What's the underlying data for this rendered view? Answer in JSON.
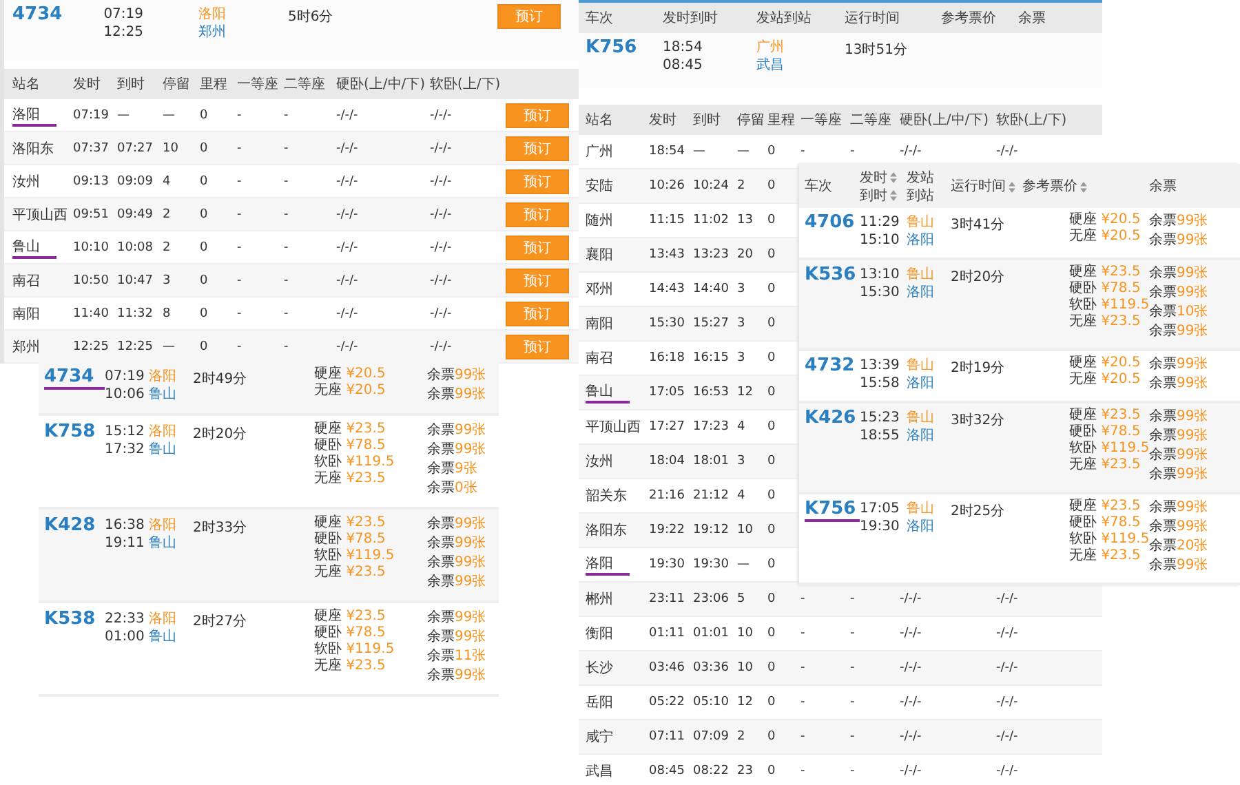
{
  "schedule_left": {
    "train": {
      "number": "4734",
      "depart": "07:19",
      "arrive": "12:25",
      "from": "洛阳",
      "to": "郑州",
      "duration": "5时6分",
      "button": "预订"
    },
    "columns": [
      "站名",
      "发时",
      "到时",
      "停留",
      "里程",
      "一等座",
      "二等座",
      "硬卧(上/中/下)",
      "软卧(上/下)"
    ],
    "stops": [
      {
        "name": "洛阳",
        "marked": true,
        "cells": [
          "07:19",
          "—",
          "—",
          "0",
          "-",
          "-",
          "-/-/-",
          "-/-/-"
        ],
        "button": "预订"
      },
      {
        "name": "洛阳东",
        "marked": false,
        "cells": [
          "07:37",
          "07:27",
          "10",
          "0",
          "-",
          "-",
          "-/-/-",
          "-/-/-"
        ],
        "button": "预订"
      },
      {
        "name": "汝州",
        "marked": false,
        "cells": [
          "09:13",
          "09:09",
          "4",
          "0",
          "-",
          "-",
          "-/-/-",
          "-/-/-"
        ],
        "button": "预订"
      },
      {
        "name": "平顶山西",
        "marked": false,
        "cells": [
          "09:51",
          "09:49",
          "2",
          "0",
          "-",
          "-",
          "-/-/-",
          "-/-/-"
        ],
        "button": "预订"
      },
      {
        "name": "鲁山",
        "marked": true,
        "cells": [
          "10:10",
          "10:08",
          "2",
          "0",
          "-",
          "-",
          "-/-/-",
          "-/-/-"
        ],
        "button": "预订"
      },
      {
        "name": "南召",
        "marked": false,
        "cells": [
          "10:50",
          "10:47",
          "3",
          "0",
          "-",
          "-",
          "-/-/-",
          "-/-/-"
        ],
        "button": "预订"
      },
      {
        "name": "南阳",
        "marked": false,
        "cells": [
          "11:40",
          "11:32",
          "8",
          "0",
          "-",
          "-",
          "-/-/-",
          "-/-/-"
        ],
        "button": "预订"
      },
      {
        "name": "郑州",
        "marked": false,
        "cells": [
          "12:25",
          "12:25",
          "—",
          "0",
          "-",
          "-",
          "-/-/-",
          "-/-/-"
        ],
        "button": "预订"
      }
    ]
  },
  "results_left": {
    "trains": [
      {
        "number": "4734",
        "marked": true,
        "depart": "07:19",
        "arrive": "10:06",
        "from": "洛阳",
        "to": "鲁山",
        "duration": "2时49分",
        "fares": [
          {
            "seat": "硬座",
            "price": "¥20.5"
          },
          {
            "seat": "无座",
            "price": "¥20.5"
          }
        ],
        "tickets": [
          {
            "label": "余票",
            "count": "99张"
          },
          {
            "label": "余票",
            "count": "99张"
          }
        ]
      },
      {
        "number": "K758",
        "marked": false,
        "depart": "15:12",
        "arrive": "17:32",
        "from": "洛阳",
        "to": "鲁山",
        "duration": "2时20分",
        "fares": [
          {
            "seat": "硬座",
            "price": "¥23.5"
          },
          {
            "seat": "硬卧",
            "price": "¥78.5"
          },
          {
            "seat": "软卧",
            "price": "¥119.5"
          },
          {
            "seat": "无座",
            "price": "¥23.5"
          }
        ],
        "tickets": [
          {
            "label": "余票",
            "count": "99张"
          },
          {
            "label": "余票",
            "count": "99张"
          },
          {
            "label": "余票",
            "count": "9张"
          },
          {
            "label": "余票",
            "count": "0张"
          }
        ]
      },
      {
        "number": "K428",
        "marked": false,
        "depart": "16:38",
        "arrive": "19:11",
        "from": "洛阳",
        "to": "鲁山",
        "duration": "2时33分",
        "fares": [
          {
            "seat": "硬座",
            "price": "¥23.5"
          },
          {
            "seat": "硬卧",
            "price": "¥78.5"
          },
          {
            "seat": "软卧",
            "price": "¥119.5"
          },
          {
            "seat": "无座",
            "price": "¥23.5"
          }
        ],
        "tickets": [
          {
            "label": "余票",
            "count": "99张"
          },
          {
            "label": "余票",
            "count": "99张"
          },
          {
            "label": "余票",
            "count": "99张"
          },
          {
            "label": "余票",
            "count": "99张"
          }
        ]
      },
      {
        "number": "K538",
        "marked": false,
        "depart": "22:33",
        "arrive": "01:00",
        "from": "洛阳",
        "to": "鲁山",
        "duration": "2时27分",
        "fares": [
          {
            "seat": "硬座",
            "price": "¥23.5"
          },
          {
            "seat": "硬卧",
            "price": "¥78.5"
          },
          {
            "seat": "软卧",
            "price": "¥119.5"
          },
          {
            "seat": "无座",
            "price": "¥23.5"
          }
        ],
        "tickets": [
          {
            "label": "余票",
            "count": "99张"
          },
          {
            "label": "余票",
            "count": "99张"
          },
          {
            "label": "余票",
            "count": "11张"
          },
          {
            "label": "余票",
            "count": "99张"
          }
        ]
      }
    ]
  },
  "schedule_right": {
    "columns": [
      "车次",
      "发时到时",
      "发站到站",
      "运行时间",
      "参考票价",
      "余票"
    ],
    "train": {
      "number": "K756",
      "depart": "18:54",
      "arrive": "08:45",
      "from": "广州",
      "to": "武昌",
      "duration": "13时51分"
    },
    "stop_columns": [
      "站名",
      "发时",
      "到时",
      "停留",
      "里程",
      "一等座",
      "二等座",
      "硬卧(上/中/下)",
      "软卧(上/下)"
    ],
    "stops": [
      {
        "name": "广州",
        "marked": false,
        "cells": [
          "18:54",
          "—",
          "—",
          "0",
          "-",
          "-",
          "-/-/-",
          "-/-/-"
        ]
      },
      {
        "name": "安陆",
        "marked": false,
        "cells": [
          "10:26",
          "10:24",
          "2",
          "0"
        ]
      },
      {
        "name": "随州",
        "marked": false,
        "cells": [
          "11:15",
          "11:02",
          "13",
          "0"
        ]
      },
      {
        "name": "襄阳",
        "marked": false,
        "cells": [
          "13:43",
          "13:23",
          "20",
          "0"
        ]
      },
      {
        "name": "邓州",
        "marked": false,
        "cells": [
          "14:43",
          "14:40",
          "3",
          "0"
        ]
      },
      {
        "name": "南阳",
        "marked": false,
        "cells": [
          "15:30",
          "15:27",
          "3",
          "0"
        ]
      },
      {
        "name": "南召",
        "marked": false,
        "cells": [
          "16:18",
          "16:15",
          "3",
          "0"
        ]
      },
      {
        "name": "鲁山",
        "marked": true,
        "cells": [
          "17:05",
          "16:53",
          "12",
          "0"
        ]
      },
      {
        "name": "平顶山西",
        "marked": false,
        "cells": [
          "17:27",
          "17:23",
          "4",
          "0"
        ]
      },
      {
        "name": "汝州",
        "marked": false,
        "cells": [
          "18:04",
          "18:01",
          "3",
          "0"
        ]
      },
      {
        "name": "韶关东",
        "marked": false,
        "cells": [
          "21:16",
          "21:12",
          "4",
          "0"
        ]
      },
      {
        "name": "洛阳东",
        "marked": false,
        "cells": [
          "19:22",
          "19:12",
          "10",
          "0"
        ]
      },
      {
        "name": "洛阳",
        "marked": true,
        "cells": [
          "19:30",
          "19:30",
          "—",
          "0"
        ]
      },
      {
        "name": "郴州",
        "marked": false,
        "cells": [
          "23:11",
          "23:06",
          "5",
          "0",
          "-",
          "-",
          "-/-/-",
          "-/-/-"
        ]
      },
      {
        "name": "衡阳",
        "marked": false,
        "cells": [
          "01:11",
          "01:01",
          "10",
          "0",
          "-",
          "-",
          "-/-/-",
          "-/-/-"
        ]
      },
      {
        "name": "长沙",
        "marked": false,
        "cells": [
          "03:46",
          "03:36",
          "10",
          "0",
          "-",
          "-",
          "-/-/-",
          "-/-/-"
        ]
      },
      {
        "name": "岳阳",
        "marked": false,
        "cells": [
          "05:22",
          "05:10",
          "12",
          "0",
          "-",
          "-",
          "-/-/-",
          "-/-/-"
        ]
      },
      {
        "name": "咸宁",
        "marked": false,
        "cells": [
          "07:11",
          "07:09",
          "2",
          "0",
          "-",
          "-",
          "-/-/-",
          "-/-/-"
        ]
      },
      {
        "name": "武昌",
        "marked": false,
        "cells": [
          "08:45",
          "08:22",
          "23",
          "0",
          "-",
          "-",
          "-/-/-",
          "-/-/-"
        ]
      }
    ]
  },
  "results_right": {
    "columns": [
      {
        "labels": [
          "车次"
        ],
        "sortable": false
      },
      {
        "labels": [
          "发时",
          "到时"
        ],
        "sortable": true
      },
      {
        "labels": [
          "发站",
          "到站"
        ],
        "sortable": false
      },
      {
        "labels": [
          "运行时间"
        ],
        "sortable": true
      },
      {
        "labels": [
          "参考票价"
        ],
        "sortable": true
      },
      {
        "labels": [
          "余票"
        ],
        "sortable": false
      }
    ],
    "trains": [
      {
        "number": "4706",
        "marked": false,
        "depart": "11:29",
        "arrive": "15:10",
        "from": "鲁山",
        "to": "洛阳",
        "duration": "3时41分",
        "fares": [
          {
            "seat": "硬座",
            "price": "¥20.5"
          },
          {
            "seat": "无座",
            "price": "¥20.5"
          }
        ],
        "tickets": [
          {
            "label": "余票",
            "count": "99张"
          },
          {
            "label": "余票",
            "count": "99张"
          }
        ]
      },
      {
        "number": "K536",
        "marked": false,
        "depart": "13:10",
        "arrive": "15:30",
        "from": "鲁山",
        "to": "洛阳",
        "duration": "2时20分",
        "fares": [
          {
            "seat": "硬座",
            "price": "¥23.5"
          },
          {
            "seat": "硬卧",
            "price": "¥78.5"
          },
          {
            "seat": "软卧",
            "price": "¥119.5"
          },
          {
            "seat": "无座",
            "price": "¥23.5"
          }
        ],
        "tickets": [
          {
            "label": "余票",
            "count": "99张"
          },
          {
            "label": "余票",
            "count": "99张"
          },
          {
            "label": "余票",
            "count": "10张"
          },
          {
            "label": "余票",
            "count": "99张"
          }
        ]
      },
      {
        "number": "4732",
        "marked": false,
        "depart": "13:39",
        "arrive": "15:58",
        "from": "鲁山",
        "to": "洛阳",
        "duration": "2时19分",
        "fares": [
          {
            "seat": "硬座",
            "price": "¥20.5"
          },
          {
            "seat": "无座",
            "price": "¥20.5"
          }
        ],
        "tickets": [
          {
            "label": "余票",
            "count": "99张"
          },
          {
            "label": "余票",
            "count": "99张"
          }
        ]
      },
      {
        "number": "K426",
        "marked": false,
        "depart": "15:23",
        "arrive": "18:55",
        "from": "鲁山",
        "to": "洛阳",
        "duration": "3时32分",
        "fares": [
          {
            "seat": "硬座",
            "price": "¥23.5"
          },
          {
            "seat": "硬卧",
            "price": "¥78.5"
          },
          {
            "seat": "软卧",
            "price": "¥119.5"
          },
          {
            "seat": "无座",
            "price": "¥23.5"
          }
        ],
        "tickets": [
          {
            "label": "余票",
            "count": "99张"
          },
          {
            "label": "余票",
            "count": "99张"
          },
          {
            "label": "余票",
            "count": "99张"
          },
          {
            "label": "余票",
            "count": "99张"
          }
        ]
      },
      {
        "number": "K756",
        "marked": true,
        "depart": "17:05",
        "arrive": "19:30",
        "from": "鲁山",
        "to": "洛阳",
        "duration": "2时25分",
        "fares": [
          {
            "seat": "硬座",
            "price": "¥23.5"
          },
          {
            "seat": "硬卧",
            "price": "¥78.5"
          },
          {
            "seat": "软卧",
            "price": "¥119.5"
          },
          {
            "seat": "无座",
            "price": "¥23.5"
          }
        ],
        "tickets": [
          {
            "label": "余票",
            "count": "99张"
          },
          {
            "label": "余票",
            "count": "99张"
          },
          {
            "label": "余票",
            "count": "20张"
          },
          {
            "label": "余票",
            "count": "99张"
          }
        ]
      }
    ]
  }
}
